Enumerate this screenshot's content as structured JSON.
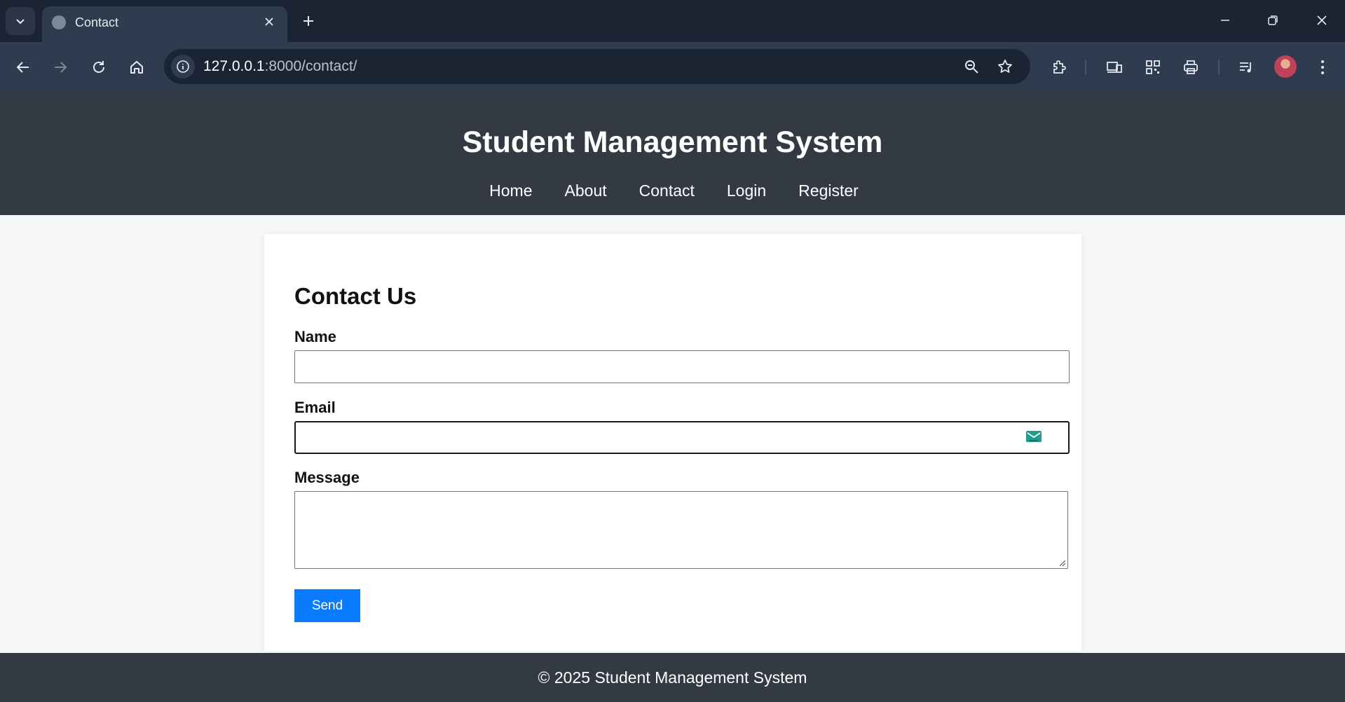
{
  "browser": {
    "tab": {
      "title": "Contact"
    },
    "address": {
      "host": "127.0.0.1",
      "path": ":8000/contact/"
    }
  },
  "site": {
    "title": "Student Management System",
    "nav": [
      "Home",
      "About",
      "Contact",
      "Login",
      "Register"
    ]
  },
  "contact_form": {
    "heading": "Contact Us",
    "name_label": "Name",
    "name_value": "",
    "email_label": "Email",
    "email_value": "",
    "message_label": "Message",
    "message_value": "",
    "submit_label": "Send"
  },
  "footer": {
    "text": "© 2025 Student Management System"
  },
  "colors": {
    "header_bg": "#343a43",
    "button_bg": "#0a7bff",
    "page_bg": "#f4f6f8"
  }
}
